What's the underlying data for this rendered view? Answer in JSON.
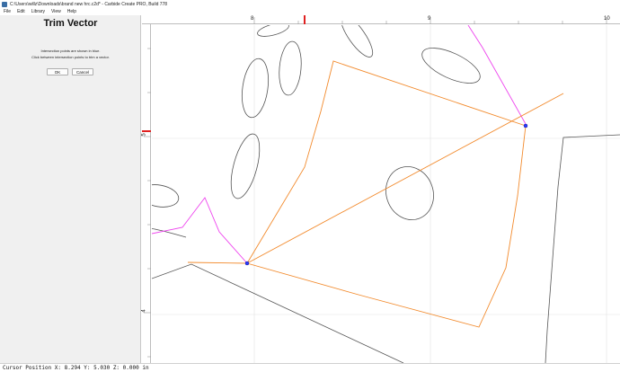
{
  "window": {
    "title": "C:\\Users\\willz\\Downloads\\brand new hrc.c2d* - Carbide Create PRO, Build 778"
  },
  "menu": {
    "items": [
      "File",
      "Edit",
      "Library",
      "View",
      "Help"
    ]
  },
  "panel": {
    "title": "Trim Vector",
    "line1": "Intersection points are shown in blue.",
    "line2": "Click between intersection points to trim a vector.",
    "ok_label": "OK",
    "cancel_label": "Cancel"
  },
  "rulers": {
    "top_labels": [
      "8",
      "9",
      "10"
    ],
    "left_labels": [
      "5",
      "4"
    ]
  },
  "colors": {
    "selected_vector": "#f28a2c",
    "trim_preview": "#ee44ee",
    "vector": "#555555",
    "intersection": "#2a3cff",
    "ruler_marker": "#e02020"
  },
  "status": {
    "text": "Cursor Position X: 8.294 Y: 5.030 Z: 0.000 in"
  }
}
